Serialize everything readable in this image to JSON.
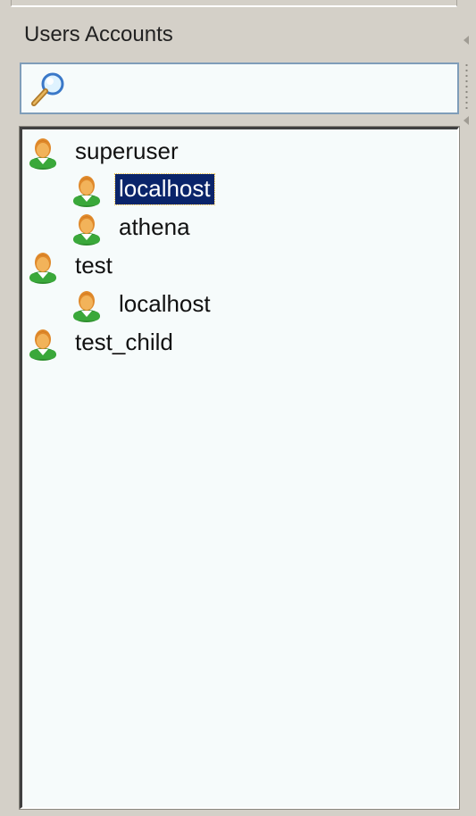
{
  "panel": {
    "title": "Users Accounts"
  },
  "search": {
    "value": "",
    "icon": "search-icon"
  },
  "tree": {
    "nodes": [
      {
        "label": "superuser",
        "level": 0,
        "icon": "user-icon",
        "selected": false
      },
      {
        "label": "localhost",
        "level": 1,
        "icon": "user-icon",
        "selected": true
      },
      {
        "label": "athena",
        "level": 1,
        "icon": "user-icon",
        "selected": false
      },
      {
        "label": "test",
        "level": 0,
        "icon": "user-icon",
        "selected": false
      },
      {
        "label": "localhost",
        "level": 1,
        "icon": "user-icon",
        "selected": false
      },
      {
        "label": "test_child",
        "level": 0,
        "icon": "user-icon",
        "selected": false
      }
    ]
  },
  "colors": {
    "selection": "#0a246a",
    "panel_bg": "#d4d0c8",
    "field_bg": "#f6fbfb"
  }
}
